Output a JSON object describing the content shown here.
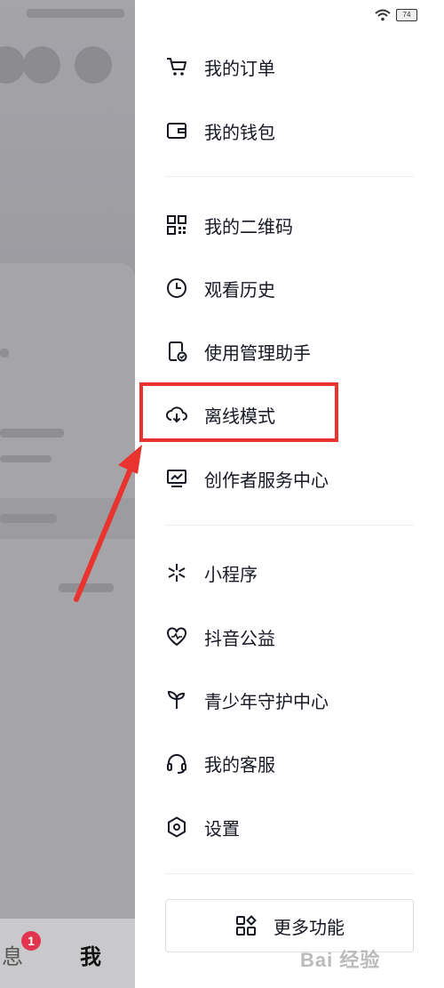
{
  "menu": {
    "group1": [
      {
        "label": "我的订单",
        "icon": "cart-icon"
      },
      {
        "label": "我的钱包",
        "icon": "wallet-icon"
      }
    ],
    "group2": [
      {
        "label": "我的二维码",
        "icon": "qr-code-icon"
      },
      {
        "label": "观看历史",
        "icon": "clock-icon"
      },
      {
        "label": "使用管理助手",
        "icon": "phone-check-icon"
      },
      {
        "label": "离线模式",
        "icon": "cloud-download-icon"
      },
      {
        "label": "创作者服务中心",
        "icon": "monitor-chart-icon"
      }
    ],
    "group3": [
      {
        "label": "小程序",
        "icon": "spark-icon"
      },
      {
        "label": "抖音公益",
        "icon": "heart-pulse-icon"
      },
      {
        "label": "青少年守护中心",
        "icon": "sprout-icon"
      },
      {
        "label": "我的客服",
        "icon": "headset-icon"
      },
      {
        "label": "设置",
        "icon": "hexagon-settings-icon"
      }
    ],
    "more_button": "更多功能"
  },
  "status_bar": {
    "battery": "74"
  },
  "bottom_nav": {
    "messages": "息",
    "messages_badge": "1",
    "me": "我"
  },
  "watermark": "Bai 经验",
  "colors": {
    "highlight": "#e8332e",
    "badge": "#e0344f",
    "text": "#161823"
  }
}
